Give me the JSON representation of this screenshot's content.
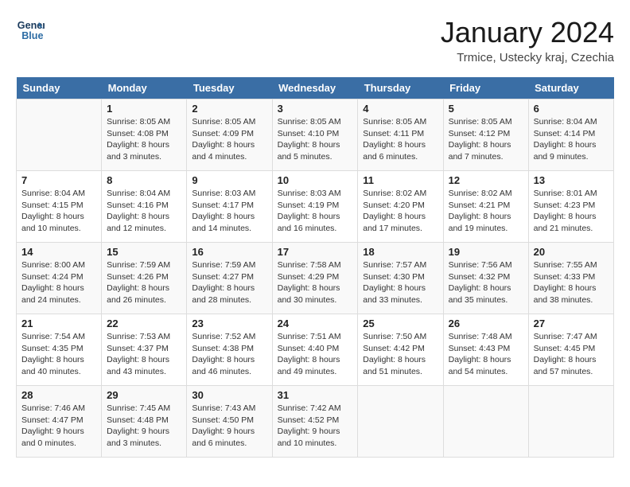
{
  "logo": {
    "line1": "General",
    "line2": "Blue"
  },
  "title": "January 2024",
  "location": "Trmice, Ustecky kraj, Czechia",
  "weekdays": [
    "Sunday",
    "Monday",
    "Tuesday",
    "Wednesday",
    "Thursday",
    "Friday",
    "Saturday"
  ],
  "weeks": [
    [
      {
        "day": "",
        "info": ""
      },
      {
        "day": "1",
        "info": "Sunrise: 8:05 AM\nSunset: 4:08 PM\nDaylight: 8 hours\nand 3 minutes."
      },
      {
        "day": "2",
        "info": "Sunrise: 8:05 AM\nSunset: 4:09 PM\nDaylight: 8 hours\nand 4 minutes."
      },
      {
        "day": "3",
        "info": "Sunrise: 8:05 AM\nSunset: 4:10 PM\nDaylight: 8 hours\nand 5 minutes."
      },
      {
        "day": "4",
        "info": "Sunrise: 8:05 AM\nSunset: 4:11 PM\nDaylight: 8 hours\nand 6 minutes."
      },
      {
        "day": "5",
        "info": "Sunrise: 8:05 AM\nSunset: 4:12 PM\nDaylight: 8 hours\nand 7 minutes."
      },
      {
        "day": "6",
        "info": "Sunrise: 8:04 AM\nSunset: 4:14 PM\nDaylight: 8 hours\nand 9 minutes."
      }
    ],
    [
      {
        "day": "7",
        "info": "Sunrise: 8:04 AM\nSunset: 4:15 PM\nDaylight: 8 hours\nand 10 minutes."
      },
      {
        "day": "8",
        "info": "Sunrise: 8:04 AM\nSunset: 4:16 PM\nDaylight: 8 hours\nand 12 minutes."
      },
      {
        "day": "9",
        "info": "Sunrise: 8:03 AM\nSunset: 4:17 PM\nDaylight: 8 hours\nand 14 minutes."
      },
      {
        "day": "10",
        "info": "Sunrise: 8:03 AM\nSunset: 4:19 PM\nDaylight: 8 hours\nand 16 minutes."
      },
      {
        "day": "11",
        "info": "Sunrise: 8:02 AM\nSunset: 4:20 PM\nDaylight: 8 hours\nand 17 minutes."
      },
      {
        "day": "12",
        "info": "Sunrise: 8:02 AM\nSunset: 4:21 PM\nDaylight: 8 hours\nand 19 minutes."
      },
      {
        "day": "13",
        "info": "Sunrise: 8:01 AM\nSunset: 4:23 PM\nDaylight: 8 hours\nand 21 minutes."
      }
    ],
    [
      {
        "day": "14",
        "info": "Sunrise: 8:00 AM\nSunset: 4:24 PM\nDaylight: 8 hours\nand 24 minutes."
      },
      {
        "day": "15",
        "info": "Sunrise: 7:59 AM\nSunset: 4:26 PM\nDaylight: 8 hours\nand 26 minutes."
      },
      {
        "day": "16",
        "info": "Sunrise: 7:59 AM\nSunset: 4:27 PM\nDaylight: 8 hours\nand 28 minutes."
      },
      {
        "day": "17",
        "info": "Sunrise: 7:58 AM\nSunset: 4:29 PM\nDaylight: 8 hours\nand 30 minutes."
      },
      {
        "day": "18",
        "info": "Sunrise: 7:57 AM\nSunset: 4:30 PM\nDaylight: 8 hours\nand 33 minutes."
      },
      {
        "day": "19",
        "info": "Sunrise: 7:56 AM\nSunset: 4:32 PM\nDaylight: 8 hours\nand 35 minutes."
      },
      {
        "day": "20",
        "info": "Sunrise: 7:55 AM\nSunset: 4:33 PM\nDaylight: 8 hours\nand 38 minutes."
      }
    ],
    [
      {
        "day": "21",
        "info": "Sunrise: 7:54 AM\nSunset: 4:35 PM\nDaylight: 8 hours\nand 40 minutes."
      },
      {
        "day": "22",
        "info": "Sunrise: 7:53 AM\nSunset: 4:37 PM\nDaylight: 8 hours\nand 43 minutes."
      },
      {
        "day": "23",
        "info": "Sunrise: 7:52 AM\nSunset: 4:38 PM\nDaylight: 8 hours\nand 46 minutes."
      },
      {
        "day": "24",
        "info": "Sunrise: 7:51 AM\nSunset: 4:40 PM\nDaylight: 8 hours\nand 49 minutes."
      },
      {
        "day": "25",
        "info": "Sunrise: 7:50 AM\nSunset: 4:42 PM\nDaylight: 8 hours\nand 51 minutes."
      },
      {
        "day": "26",
        "info": "Sunrise: 7:48 AM\nSunset: 4:43 PM\nDaylight: 8 hours\nand 54 minutes."
      },
      {
        "day": "27",
        "info": "Sunrise: 7:47 AM\nSunset: 4:45 PM\nDaylight: 8 hours\nand 57 minutes."
      }
    ],
    [
      {
        "day": "28",
        "info": "Sunrise: 7:46 AM\nSunset: 4:47 PM\nDaylight: 9 hours\nand 0 minutes."
      },
      {
        "day": "29",
        "info": "Sunrise: 7:45 AM\nSunset: 4:48 PM\nDaylight: 9 hours\nand 3 minutes."
      },
      {
        "day": "30",
        "info": "Sunrise: 7:43 AM\nSunset: 4:50 PM\nDaylight: 9 hours\nand 6 minutes."
      },
      {
        "day": "31",
        "info": "Sunrise: 7:42 AM\nSunset: 4:52 PM\nDaylight: 9 hours\nand 10 minutes."
      },
      {
        "day": "",
        "info": ""
      },
      {
        "day": "",
        "info": ""
      },
      {
        "day": "",
        "info": ""
      }
    ]
  ]
}
